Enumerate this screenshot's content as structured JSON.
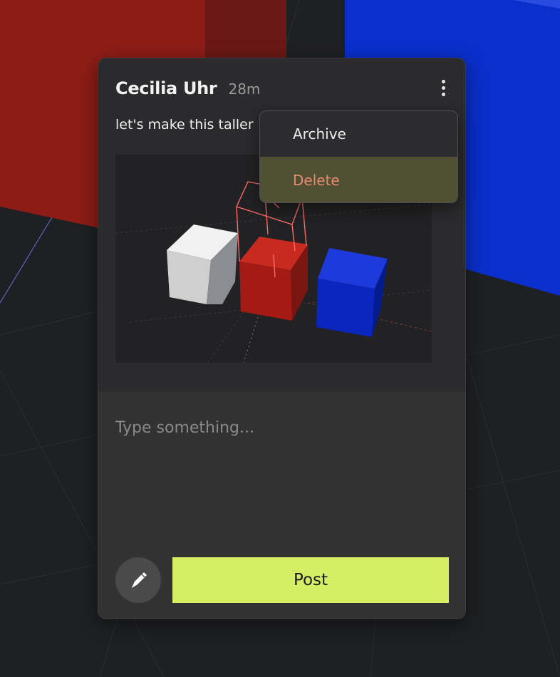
{
  "comment": {
    "author": "Cecilia Uhr",
    "time": "28m",
    "text": "let's make this taller"
  },
  "attachment": {
    "scene": [
      "white-cube",
      "red-cube-with-sketch",
      "blue-cube"
    ]
  },
  "menu": {
    "items": [
      {
        "label": "Archive",
        "variant": "default"
      },
      {
        "label": "Delete",
        "variant": "danger"
      }
    ]
  },
  "reply": {
    "placeholder": "Type something...",
    "post_label": "Post"
  },
  "icons": {
    "more": "more-vertical-icon",
    "draw": "pencil-icon"
  },
  "colors": {
    "accent": "#d6ee64",
    "danger": "#e88a6e",
    "menu_highlight": "#4f5034",
    "card_bg": "#2b2b2d"
  }
}
